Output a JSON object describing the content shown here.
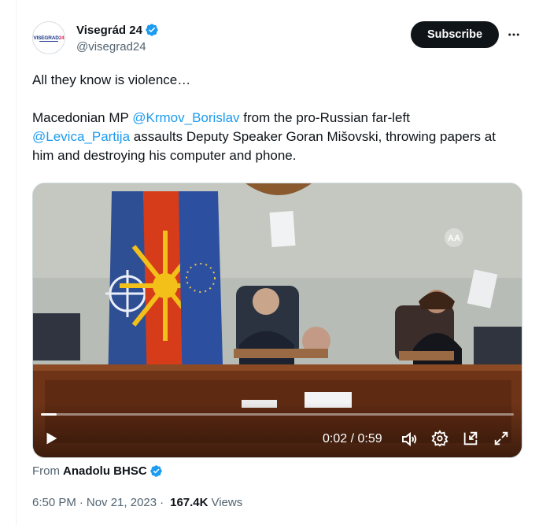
{
  "author": {
    "display_name": "Visegrád 24",
    "handle": "@visegrad24",
    "avatar_label_main": "VISEGRAD",
    "avatar_label_accent": "24",
    "verified_icon": "verified-badge-icon"
  },
  "actions": {
    "subscribe_label": "Subscribe",
    "more_icon": "more-horizontal-icon"
  },
  "tweet": {
    "line1": "All they know is violence…",
    "para2_prefix": "Macedonian MP ",
    "mention1": "@Krmov_Borislav",
    "para2_mid": " from the pro-Russian far-left ",
    "mention2": "@Levica_Partija",
    "para2_suffix": " assaults Deputy Speaker Goran Mišovski, throwing papers at him and destroying his computer and phone."
  },
  "video": {
    "watermark_text": "AA",
    "current_time": "0:02",
    "separator": " / ",
    "duration": "0:59",
    "progress": 0.034,
    "icons": {
      "play": "play-icon",
      "volume": "volume-icon",
      "settings": "settings-gear-icon",
      "pip": "picture-in-picture-icon",
      "fullscreen": "fullscreen-icon"
    }
  },
  "source": {
    "from_label": "From",
    "source_name": "Anadolu BHSC"
  },
  "meta": {
    "time": "6:50 PM",
    "separator": "·",
    "date": "Nov 21, 2023",
    "views_count": "167.4K",
    "views_label": "Views"
  },
  "colors": {
    "link": "#1d9bf0",
    "text": "#0f1419",
    "secondary": "#536471",
    "button_bg": "#0f1419"
  }
}
